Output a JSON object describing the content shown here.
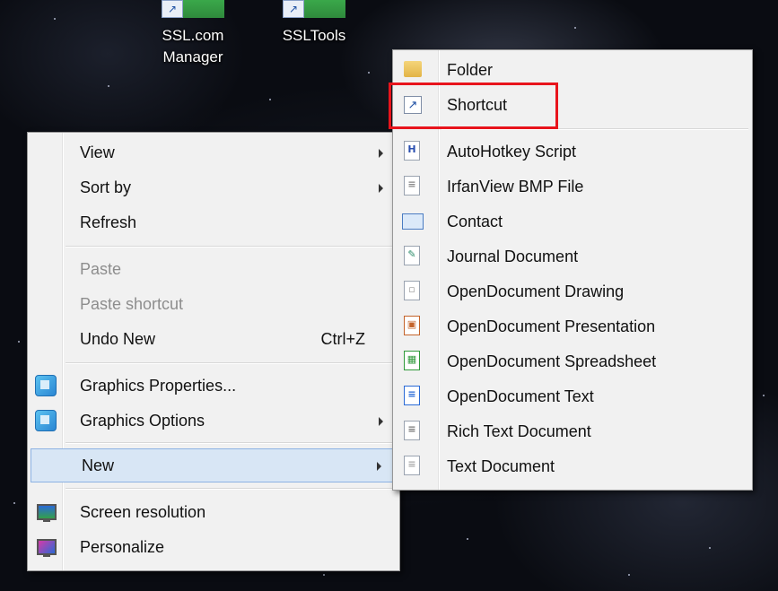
{
  "desktop": {
    "icons": [
      {
        "label_line1": "SSL.com",
        "label_line2": "Manager"
      },
      {
        "label_line1": "SSLTools",
        "label_line2": ""
      }
    ]
  },
  "context_menu": {
    "items": {
      "view": "View",
      "sort_by": "Sort by",
      "refresh": "Refresh",
      "paste": "Paste",
      "paste_shortcut": "Paste shortcut",
      "undo_new": "Undo New",
      "undo_new_shortcut": "Ctrl+Z",
      "graphics_properties": "Graphics Properties...",
      "graphics_options": "Graphics Options",
      "new": "New",
      "screen_resolution": "Screen resolution",
      "personalize": "Personalize"
    }
  },
  "new_submenu": {
    "items": {
      "folder": "Folder",
      "shortcut": "Shortcut",
      "autohotkey": "AutoHotkey Script",
      "irfanview": "IrfanView BMP File",
      "contact": "Contact",
      "journal": "Journal Document",
      "od_drawing": "OpenDocument Drawing",
      "od_presentation": "OpenDocument Presentation",
      "od_spreadsheet": "OpenDocument Spreadsheet",
      "od_text": "OpenDocument Text",
      "rich_text": "Rich Text Document",
      "text_doc": "Text Document"
    },
    "highlight_color": "#e8141c"
  }
}
